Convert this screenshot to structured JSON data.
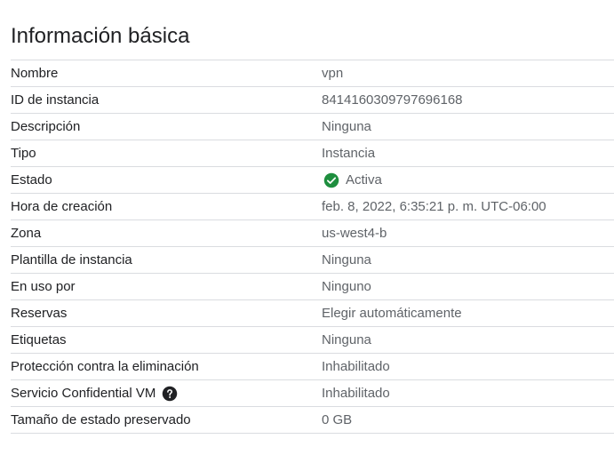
{
  "section": {
    "title": "Información básica"
  },
  "properties": [
    {
      "label": "Nombre",
      "value": "vpn"
    },
    {
      "label": "ID de instancia",
      "value": "8414160309797696168"
    },
    {
      "label": "Descripción",
      "value": "Ninguna"
    },
    {
      "label": "Tipo",
      "value": "Instancia"
    },
    {
      "label": "Estado",
      "value": "Activa",
      "icon": "check-circle-icon",
      "icon_color": "#1e8e3e"
    },
    {
      "label": "Hora de creación",
      "value": "feb. 8, 2022, 6:35:21 p. m. UTC-06:00"
    },
    {
      "label": "Zona",
      "value": "us-west4-b"
    },
    {
      "label": "Plantilla de instancia",
      "value": "Ninguna"
    },
    {
      "label": "En uso por",
      "value": "Ninguno"
    },
    {
      "label": "Reservas",
      "value": "Elegir automáticamente"
    },
    {
      "label": "Etiquetas",
      "value": "Ninguna"
    },
    {
      "label": "Protección contra la eliminación",
      "value": "Inhabilitado"
    },
    {
      "label": "Servicio Confidential VM",
      "value": "Inhabilitado",
      "label_icon": "help-icon"
    },
    {
      "label": "Tamaño de estado preservado",
      "value": "0 GB"
    }
  ],
  "colors": {
    "text_primary": "#202124",
    "text_secondary": "#5f6368",
    "divider": "#dadce0",
    "status_ok": "#1e8e3e"
  }
}
